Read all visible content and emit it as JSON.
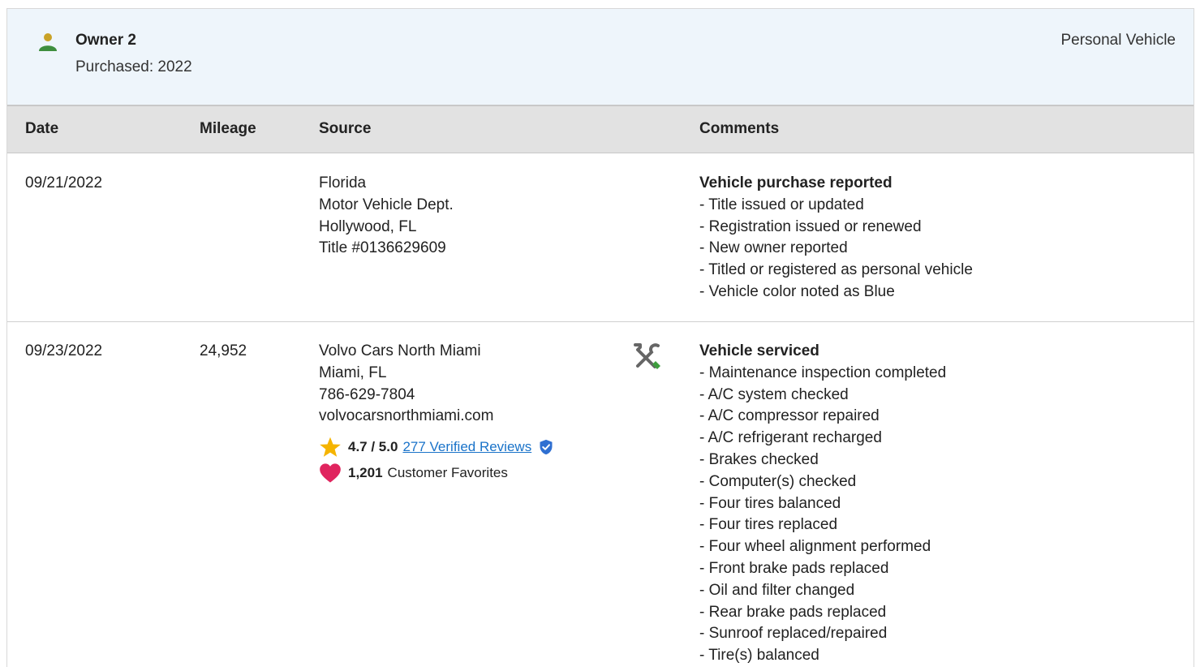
{
  "owner": {
    "name": "Owner 2",
    "purchased": "Purchased: 2022",
    "type": "Personal Vehicle"
  },
  "table": {
    "headers": {
      "date": "Date",
      "mileage": "Mileage",
      "source": "Source",
      "comments": "Comments"
    },
    "rows": [
      {
        "date": "09/21/2022",
        "mileage": "",
        "source": [
          "Florida",
          "Motor Vehicle Dept.",
          "Hollywood, FL",
          "Title #0136629609"
        ],
        "comment_title": "Vehicle purchase reported",
        "comments": [
          "- Title issued or updated",
          "- Registration issued or renewed",
          "- New owner reported",
          "- Titled or registered as personal vehicle",
          "- Vehicle color noted as Blue"
        ]
      },
      {
        "date": "09/23/2022",
        "mileage": "24,952",
        "source": [
          "Volvo Cars North Miami",
          "Miami, FL",
          "786-629-7804",
          "volvocarsnorthmiami.com"
        ],
        "rating": "4.7 / 5.0",
        "reviews_link": "277 Verified Reviews",
        "favorites_count": "1,201",
        "favorites_label": "Customer Favorites",
        "comment_title": "Vehicle serviced",
        "comments": [
          "- Maintenance inspection completed",
          "- A/C system checked",
          "- A/C compressor repaired",
          "- A/C refrigerant recharged",
          "- Brakes checked",
          "- Computer(s) checked",
          "- Four tires balanced",
          "- Four tires replaced",
          "- Four wheel alignment performed",
          "- Front brake pads replaced",
          "- Oil and filter changed",
          "- Rear brake pads replaced",
          "- Sunroof replaced/repaired",
          "- Tire(s) balanced"
        ]
      }
    ]
  },
  "icons": {
    "owner": "person-icon",
    "service": "wrench-screwdriver-icon",
    "rating": "star-icon",
    "verified": "shield-check-icon",
    "favorites": "heart-icon"
  },
  "colors": {
    "owner_head": "#c9a227",
    "owner_body": "#3e8e3e",
    "link": "#1a73c9",
    "star": "#f5b400",
    "heart": "#e0245e",
    "verified": "#2f6fd1",
    "header_bg": "#eef5fb",
    "table_head_bg": "#e2e2e2"
  }
}
